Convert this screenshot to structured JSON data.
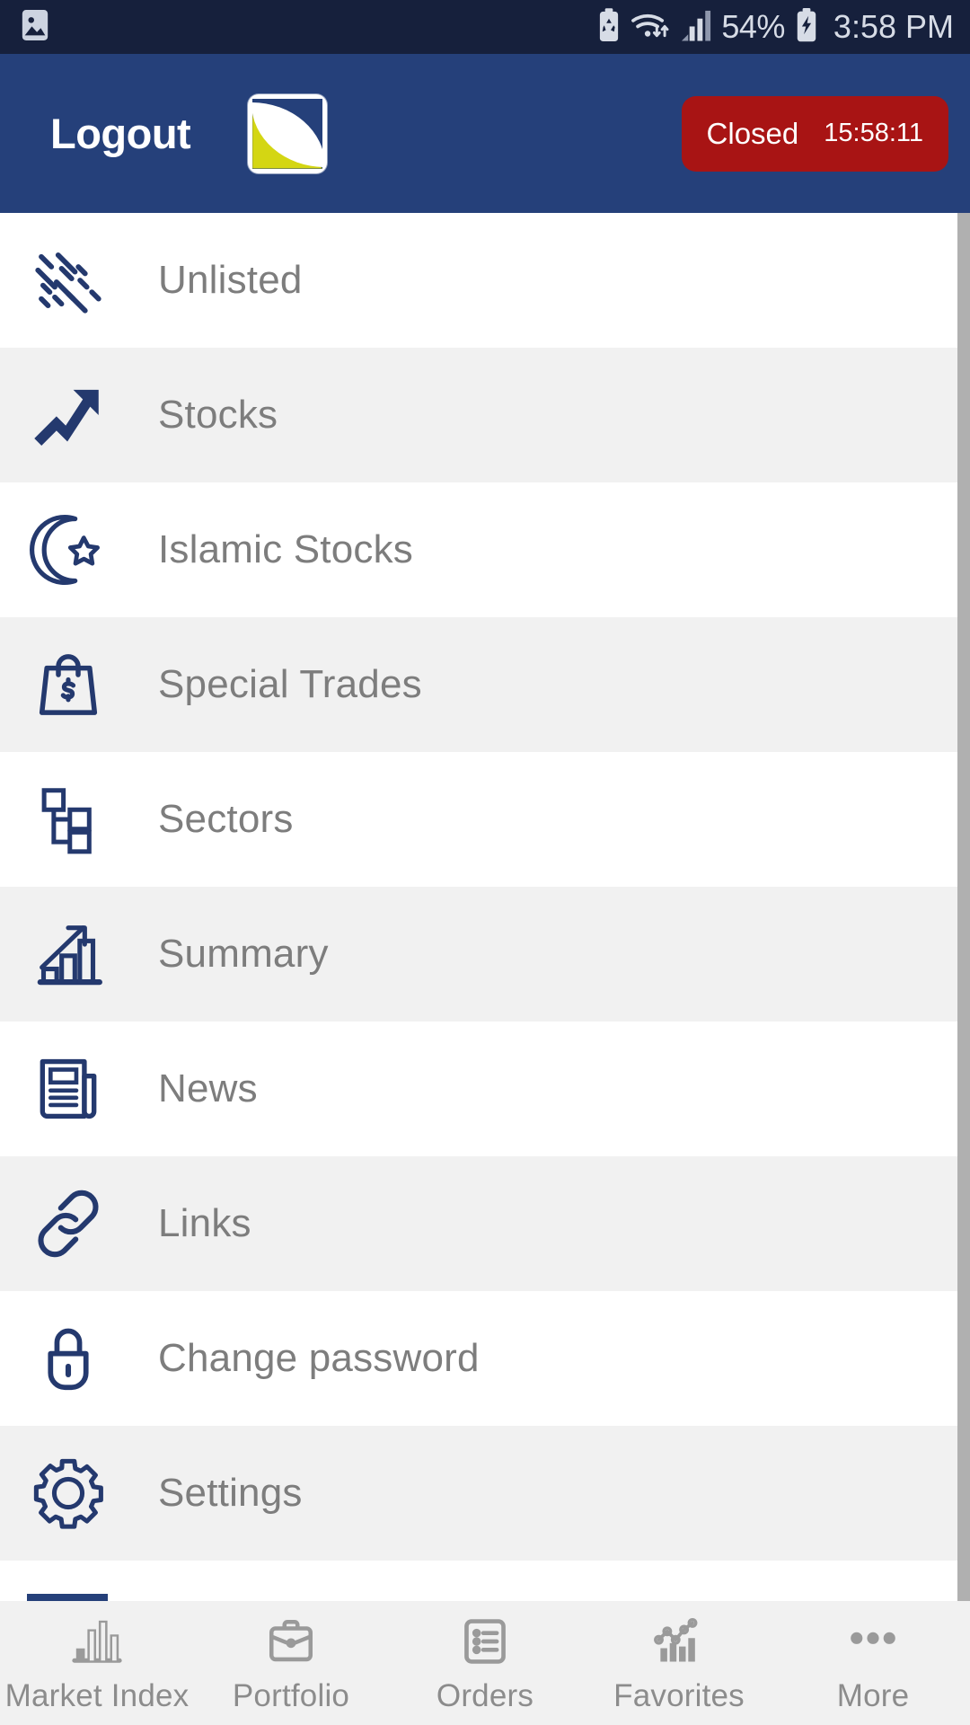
{
  "statusbar": {
    "left_icons": [
      {
        "name": "image-icon"
      }
    ],
    "right_icons": [
      {
        "name": "recycle-battery-icon"
      },
      {
        "name": "wifi-icon"
      },
      {
        "name": "cellular-signal-icon"
      }
    ],
    "battery_percent": "54%",
    "charging_icon": "battery-charging-icon",
    "time": "3:58 PM"
  },
  "header": {
    "logout_label": "Logout",
    "logo_name": "app-brand-logo",
    "market_status": "Closed",
    "market_time": "15:58:11",
    "badge_color": "#a81414",
    "bar_color": "#25407a"
  },
  "menu": {
    "items": [
      {
        "label": "Unlisted",
        "icon": "unlisted-dashes-icon"
      },
      {
        "label": "Stocks",
        "icon": "trending-up-arrow-icon"
      },
      {
        "label": "Islamic Stocks",
        "icon": "crescent-moon-star-icon"
      },
      {
        "label": "Special Trades",
        "icon": "shopping-bag-dollar-icon"
      },
      {
        "label": "Sectors",
        "icon": "hierarchy-tree-icon"
      },
      {
        "label": "Summary",
        "icon": "bar-chart-arrow-icon"
      },
      {
        "label": "News",
        "icon": "newspaper-icon"
      },
      {
        "label": "Links",
        "icon": "chain-link-icon"
      },
      {
        "label": "Change password",
        "icon": "padlock-icon"
      },
      {
        "label": "Settings",
        "icon": "gear-icon"
      }
    ],
    "icon_color": "#24396e",
    "label_color": "#7d7d7d"
  },
  "bottomnav": {
    "items": [
      {
        "label": "Market Index",
        "icon": "bar-chart-icon"
      },
      {
        "label": "Portfolio",
        "icon": "briefcase-icon"
      },
      {
        "label": "Orders",
        "icon": "list-clipboard-icon"
      },
      {
        "label": "Favorites",
        "icon": "line-bar-chart-icon"
      },
      {
        "label": "More",
        "icon": "three-dots-icon"
      }
    ],
    "active_indicator_color": "#25407a"
  }
}
